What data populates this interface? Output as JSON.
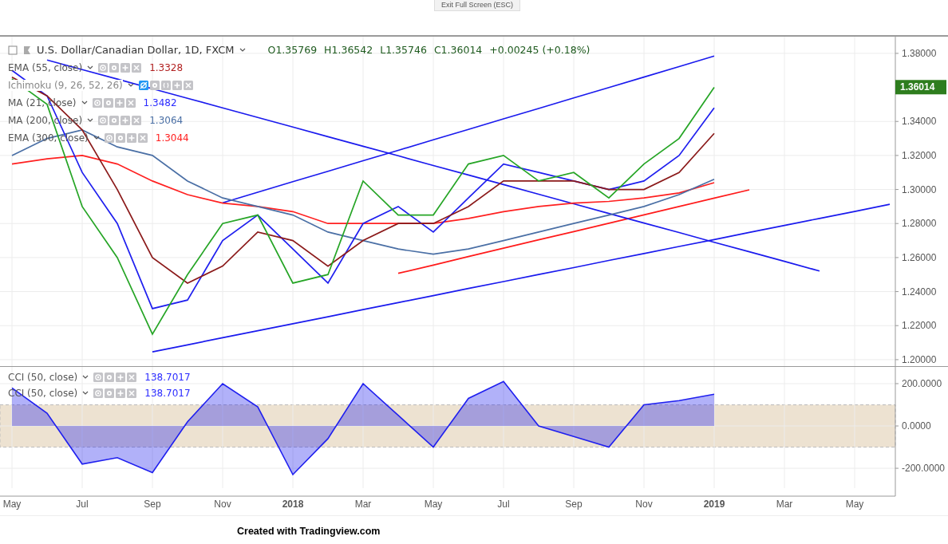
{
  "top_bar": {
    "exit_button": "Exit Full Screen (ESC)"
  },
  "price_pane": {
    "symbol": "U.S. Dollar/Canadian Dollar, 1D, FXCM",
    "ohlc": [
      {
        "label": "O",
        "value": "1.35769"
      },
      {
        "label": "H",
        "value": "1.36542"
      },
      {
        "label": "L",
        "value": "1.35746"
      },
      {
        "label": "C",
        "value": "1.36014"
      }
    ],
    "change": "+0.00245 (+0.18%)",
    "last_price_label": "1.36014",
    "indicators": [
      {
        "name": "EMA (55, close)",
        "value": "1.3328",
        "color": "#b22222",
        "hidden": false
      },
      {
        "name": "Ichimoku (9, 26, 52, 26)",
        "hidden": true
      },
      {
        "name": "MA (21, close)",
        "value": "1.3482",
        "color": "#2b2bff",
        "hidden": false
      },
      {
        "name": "MA (200, close)",
        "value": "1.3064",
        "color": "#4a6fa5",
        "hidden": false
      },
      {
        "name": "EMA (300, close)",
        "value": "1.3044",
        "color": "#ff2020",
        "hidden": false
      }
    ],
    "chart_data": {
      "type": "line",
      "grid": true,
      "categories": [
        null,
        null,
        null,
        null,
        null,
        null,
        null,
        null,
        null,
        null,
        null,
        null,
        null,
        null,
        null,
        null,
        null,
        null,
        null,
        null,
        null,
        null,
        null,
        null,
        null,
        null
      ],
      "series": [
        {
          "color": "#26a526",
          "values": [
            1.365,
            1.35,
            1.29,
            1.26,
            1.215,
            1.25,
            1.28,
            1.285,
            1.245,
            1.25,
            1.305,
            1.285,
            1.285,
            1.315,
            1.32,
            1.305,
            1.31,
            1.295,
            1.315,
            1.33,
            1.36,
            null,
            null,
            null,
            null,
            null
          ]
        },
        {
          "color": "#8b1a1a",
          "values": [
            1.366,
            1.355,
            1.335,
            1.3,
            1.26,
            1.245,
            1.255,
            1.275,
            1.27,
            1.255,
            1.27,
            1.28,
            1.28,
            1.29,
            1.305,
            1.305,
            1.305,
            1.3,
            1.3,
            1.31,
            1.333,
            null,
            null,
            null,
            null,
            null
          ]
        },
        {
          "color": "#1f1fef",
          "values": [
            1.37,
            1.355,
            1.31,
            1.28,
            1.23,
            1.235,
            1.27,
            1.285,
            1.265,
            1.245,
            1.28,
            1.29,
            1.275,
            1.295,
            1.315,
            1.31,
            1.305,
            1.3,
            1.305,
            1.32,
            1.348,
            null,
            null,
            null,
            null,
            null
          ]
        },
        {
          "color": "#4a6fa5",
          "values": [
            1.32,
            1.33,
            1.335,
            1.325,
            1.32,
            1.305,
            1.295,
            1.29,
            1.285,
            1.275,
            1.27,
            1.265,
            1.262,
            1.265,
            1.27,
            1.275,
            1.28,
            1.285,
            1.29,
            1.297,
            1.306,
            null,
            null,
            null,
            null,
            null
          ]
        },
        {
          "color": "#ff2020",
          "values": [
            1.315,
            1.318,
            1.32,
            1.315,
            1.305,
            1.297,
            1.292,
            1.29,
            1.287,
            1.28,
            1.28,
            1.28,
            1.28,
            1.283,
            1.287,
            1.29,
            1.292,
            1.293,
            1.295,
            1.298,
            1.304,
            null,
            null,
            null,
            null,
            null
          ]
        },
        {
          "color": "#1a1aee",
          "values": [
            null,
            null,
            null,
            null,
            null,
            null,
            1.2922,
            1.2984,
            1.3046,
            1.3107,
            1.3169,
            1.323,
            1.3292,
            1.3353,
            1.3415,
            1.3476,
            1.3538,
            1.3599,
            1.3661,
            1.3722,
            1.3784,
            null,
            null,
            null,
            null,
            null
          ]
        },
        {
          "color": "#1a1aee",
          "values": [
            null,
            null,
            null,
            null,
            1.2046,
            1.2087,
            1.2129,
            1.217,
            1.2211,
            1.2252,
            1.2294,
            1.2335,
            1.2376,
            1.2418,
            1.2459,
            1.25,
            1.2541,
            1.2583,
            1.2624,
            1.2665,
            1.2706,
            1.2748,
            1.2789,
            1.283,
            1.2871,
            1.2913
          ]
        },
        {
          "color": "#1a1aee",
          "values": [
            null,
            1.3761,
            1.3705,
            1.3649,
            1.3592,
            1.3536,
            1.348,
            1.3423,
            1.3367,
            1.331,
            1.3254,
            1.3198,
            1.3141,
            1.3085,
            1.3029,
            1.2972,
            1.2916,
            1.2859,
            1.2803,
            1.2747,
            1.269,
            1.2634,
            1.2578,
            1.2521,
            null,
            null
          ]
        },
        {
          "color": "#ff1a1a",
          "values": [
            null,
            null,
            null,
            null,
            null,
            null,
            null,
            null,
            null,
            null,
            null,
            1.2507,
            1.2556,
            1.2606,
            1.2655,
            1.2704,
            1.2753,
            1.2802,
            1.2851,
            1.29,
            1.2949,
            1.2998,
            null,
            null,
            null,
            null
          ]
        }
      ],
      "ylim": [
        1.1962,
        1.3898
      ],
      "yticks": [
        {
          "value": 1.2,
          "label": "1.20000"
        },
        {
          "value": 1.22,
          "label": "1.22000"
        },
        {
          "value": 1.24,
          "label": "1.24000"
        },
        {
          "value": 1.26,
          "label": "1.26000"
        },
        {
          "value": 1.28,
          "label": "1.28000"
        },
        {
          "value": 1.3,
          "label": "1.30000"
        },
        {
          "value": 1.32,
          "label": "1.32000"
        },
        {
          "value": 1.34,
          "label": "1.34000"
        },
        {
          "value": 1.38,
          "label": "1.38000"
        }
      ]
    }
  },
  "cci_pane": {
    "indicators": [
      {
        "name": "CCI (50, close)",
        "value": "138.7017",
        "color": "#2b2bff"
      },
      {
        "name": "CCI (50, close)",
        "value": "138.7017",
        "color": "#2b2bff"
      }
    ],
    "chart_data": {
      "type": "area",
      "grid": true,
      "bands": [
        {
          "axis": "y",
          "from": -100,
          "to": 100,
          "color": "#ede2d1"
        }
      ],
      "categories": [
        "May",
        null,
        "Jul",
        null,
        "Sep",
        null,
        "Nov",
        null,
        "2018",
        null,
        "Mar",
        null,
        "May",
        null,
        "Jul",
        null,
        "Sep",
        null,
        "Nov",
        null,
        "2019",
        null,
        "Mar",
        null,
        "May",
        null
      ],
      "series": [
        {
          "color": "#1f1fef",
          "values": [
            180,
            60,
            -180,
            -150,
            -220,
            20,
            200,
            90,
            -230,
            -60,
            200,
            50,
            -100,
            130,
            210,
            0,
            -50,
            -100,
            100,
            120,
            150,
            null,
            null,
            null,
            null,
            null
          ]
        }
      ],
      "ylim": [
        -294,
        279
      ],
      "yticks": [
        {
          "value": 200,
          "label": "200.0000"
        },
        {
          "value": 0,
          "label": "0.0000"
        },
        {
          "value": -200,
          "label": "-200.0000"
        }
      ]
    }
  },
  "footer": "Created with Tradingview.com"
}
